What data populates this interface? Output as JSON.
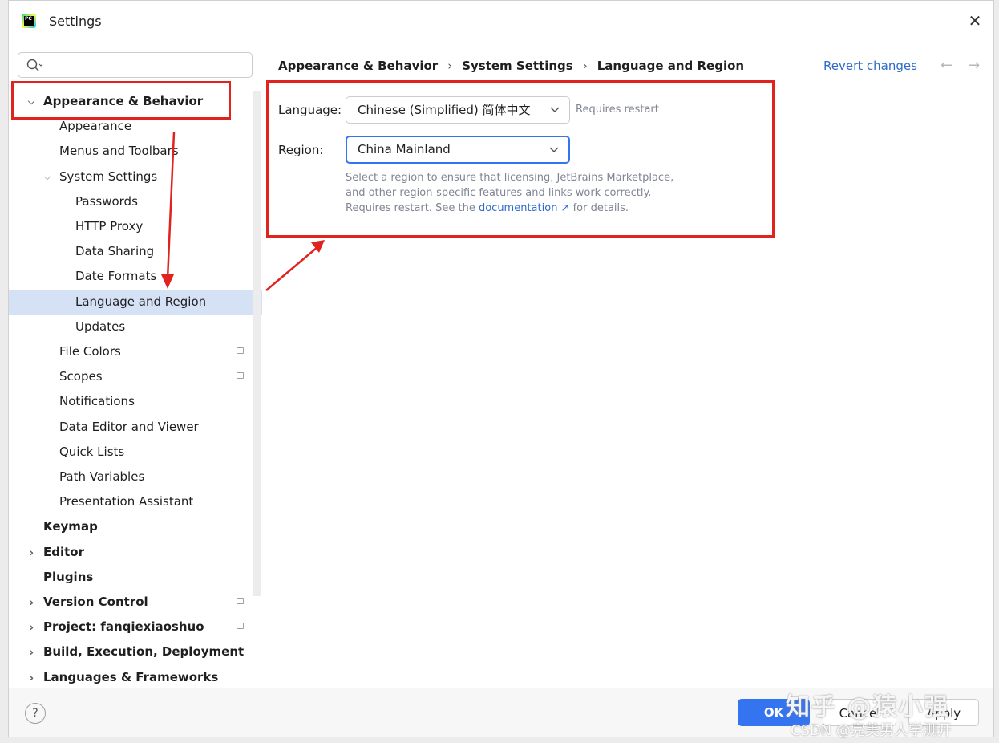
{
  "window": {
    "title": "Settings"
  },
  "search": {
    "placeholder": ""
  },
  "sidebar": {
    "items": [
      {
        "label": "Appearance & Behavior",
        "bold": true,
        "expanded": true,
        "level": 0
      },
      {
        "label": "Appearance",
        "level": 1
      },
      {
        "label": "Menus and Toolbars",
        "level": 1
      },
      {
        "label": "System Settings",
        "level": 1,
        "expanded": true
      },
      {
        "label": "Passwords",
        "level": 2
      },
      {
        "label": "HTTP Proxy",
        "level": 2
      },
      {
        "label": "Data Sharing",
        "level": 2
      },
      {
        "label": "Date Formats",
        "level": 2
      },
      {
        "label": "Language and Region",
        "level": 2,
        "selected": true
      },
      {
        "label": "Updates",
        "level": 2
      },
      {
        "label": "File Colors",
        "level": 1,
        "badge": true
      },
      {
        "label": "Scopes",
        "level": 1,
        "badge": true
      },
      {
        "label": "Notifications",
        "level": 1
      },
      {
        "label": "Data Editor and Viewer",
        "level": 1
      },
      {
        "label": "Quick Lists",
        "level": 1
      },
      {
        "label": "Path Variables",
        "level": 1
      },
      {
        "label": "Presentation Assistant",
        "level": 1
      },
      {
        "label": "Keymap",
        "bold": true,
        "level": 0
      },
      {
        "label": "Editor",
        "bold": true,
        "collapsed": true,
        "level": 0
      },
      {
        "label": "Plugins",
        "bold": true,
        "level": 0
      },
      {
        "label": "Version Control",
        "bold": true,
        "collapsed": true,
        "level": 0,
        "badge": true
      },
      {
        "label": "Project: fanqiexiaoshuo",
        "bold": true,
        "collapsed": true,
        "level": 0,
        "badge": true
      },
      {
        "label": "Build, Execution, Deployment",
        "bold": true,
        "collapsed": true,
        "level": 0
      },
      {
        "label": "Languages & Frameworks",
        "bold": true,
        "collapsed": true,
        "level": 0
      }
    ]
  },
  "breadcrumb": {
    "items": [
      "Appearance & Behavior",
      "System Settings",
      "Language and Region"
    ],
    "separator": "›"
  },
  "header": {
    "revert_label": "Revert changes",
    "back_arrow": "←",
    "forward_arrow": "→"
  },
  "form": {
    "language_label": "Language:",
    "language_value": "Chinese (Simplified) 简体中文",
    "language_hint": "Requires restart",
    "region_label": "Region:",
    "region_value": "China Mainland",
    "description_text": "Select a region to ensure that licensing, JetBrains Marketplace, and other region-specific features and links work correctly. Requires restart. See the",
    "description_link": "documentation ↗",
    "description_suffix": " for details."
  },
  "footer": {
    "help_label": "?",
    "ok_label": "OK",
    "cancel_label": "Cancel",
    "apply_label": "Apply"
  },
  "watermark": {
    "line1": "知乎 @猿小强",
    "line2": "CSDN @完美男人学测开"
  },
  "colors": {
    "accent": "#3574f0",
    "selection": "#d5e1f5",
    "annotation_red": "#e0231f",
    "link": "#2f6cc9"
  }
}
